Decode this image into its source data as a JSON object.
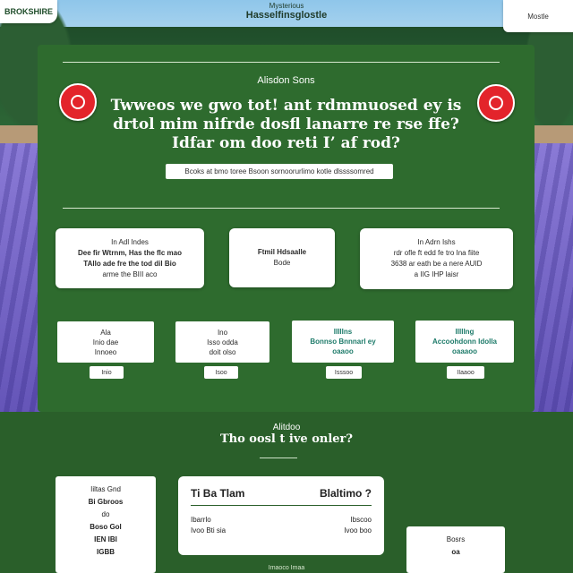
{
  "header": {
    "logo_label": "BROKSHIRE",
    "subtitle": "Mysterious",
    "title": "Hasselfinsglostle",
    "corner_button": "Mostle"
  },
  "hero": {
    "author": "Alisdon Sons",
    "quote_lines": [
      "Twweos we gwo tot! ant rdmmuosed ey is",
      "drtol mim nifrde dosfl lanarre re rse ffe?",
      "Idfar om doo reti I’ af rod?"
    ],
    "cta_label": "Bcoks at bmo toree Bsoon sornoorurlimo kotle dlssssomred"
  },
  "info_cards": [
    {
      "lines": [
        "In Adl Indes",
        "Dee fir Wtrnm, Has the flc mao",
        "TAllo ade fre the tod dil Bio",
        "arme the BIII aco"
      ]
    },
    {
      "lines": [
        "Ftmil Hdsaalle",
        "Bode"
      ]
    },
    {
      "lines": [
        "In Adrn Ishs",
        "rdr ofle ft edd fe tro Ina fiite",
        "3638 ar eath be a nere AUID",
        "a IIG IHP laisr"
      ]
    }
  ],
  "option_cards": [
    {
      "lines": [
        "Ala",
        "Inio dae",
        "Innoeo"
      ],
      "button": "Inio"
    },
    {
      "lines": [
        "Ino",
        "Isso odda",
        "doit olso"
      ],
      "button": "Isoo"
    },
    {
      "lines": [
        "IIIIIns",
        "Bonnso Bnnnarl ey",
        "oaaoo"
      ],
      "button": "Isssoo"
    },
    {
      "lines": [
        "IIIIIng",
        "Accoohdonn IdoIla",
        "oaaaoo"
      ],
      "button": "IIaaoo"
    }
  ],
  "band": {
    "author": "Alitdoo",
    "question": "Tho oosl t ive onler?"
  },
  "lower_left": {
    "lines": [
      "Iiltas Gnd",
      "Bi Gbroos",
      "do",
      "Boso Gol",
      "IEN IBI",
      "IGBB"
    ]
  },
  "lower_mid": {
    "col_left": "Ti Ba Tlam",
    "col_right": "Blaltimo ?",
    "rows": [
      {
        "left": "Ibarrlo",
        "right": "Ibscoo"
      },
      {
        "left": "Ivoo Bti sia",
        "right": "Ivoo boo"
      }
    ]
  },
  "lower_right": {
    "lines": [
      "Bosrs",
      "oa"
    ]
  },
  "footer": "Imaoco Imaa"
}
